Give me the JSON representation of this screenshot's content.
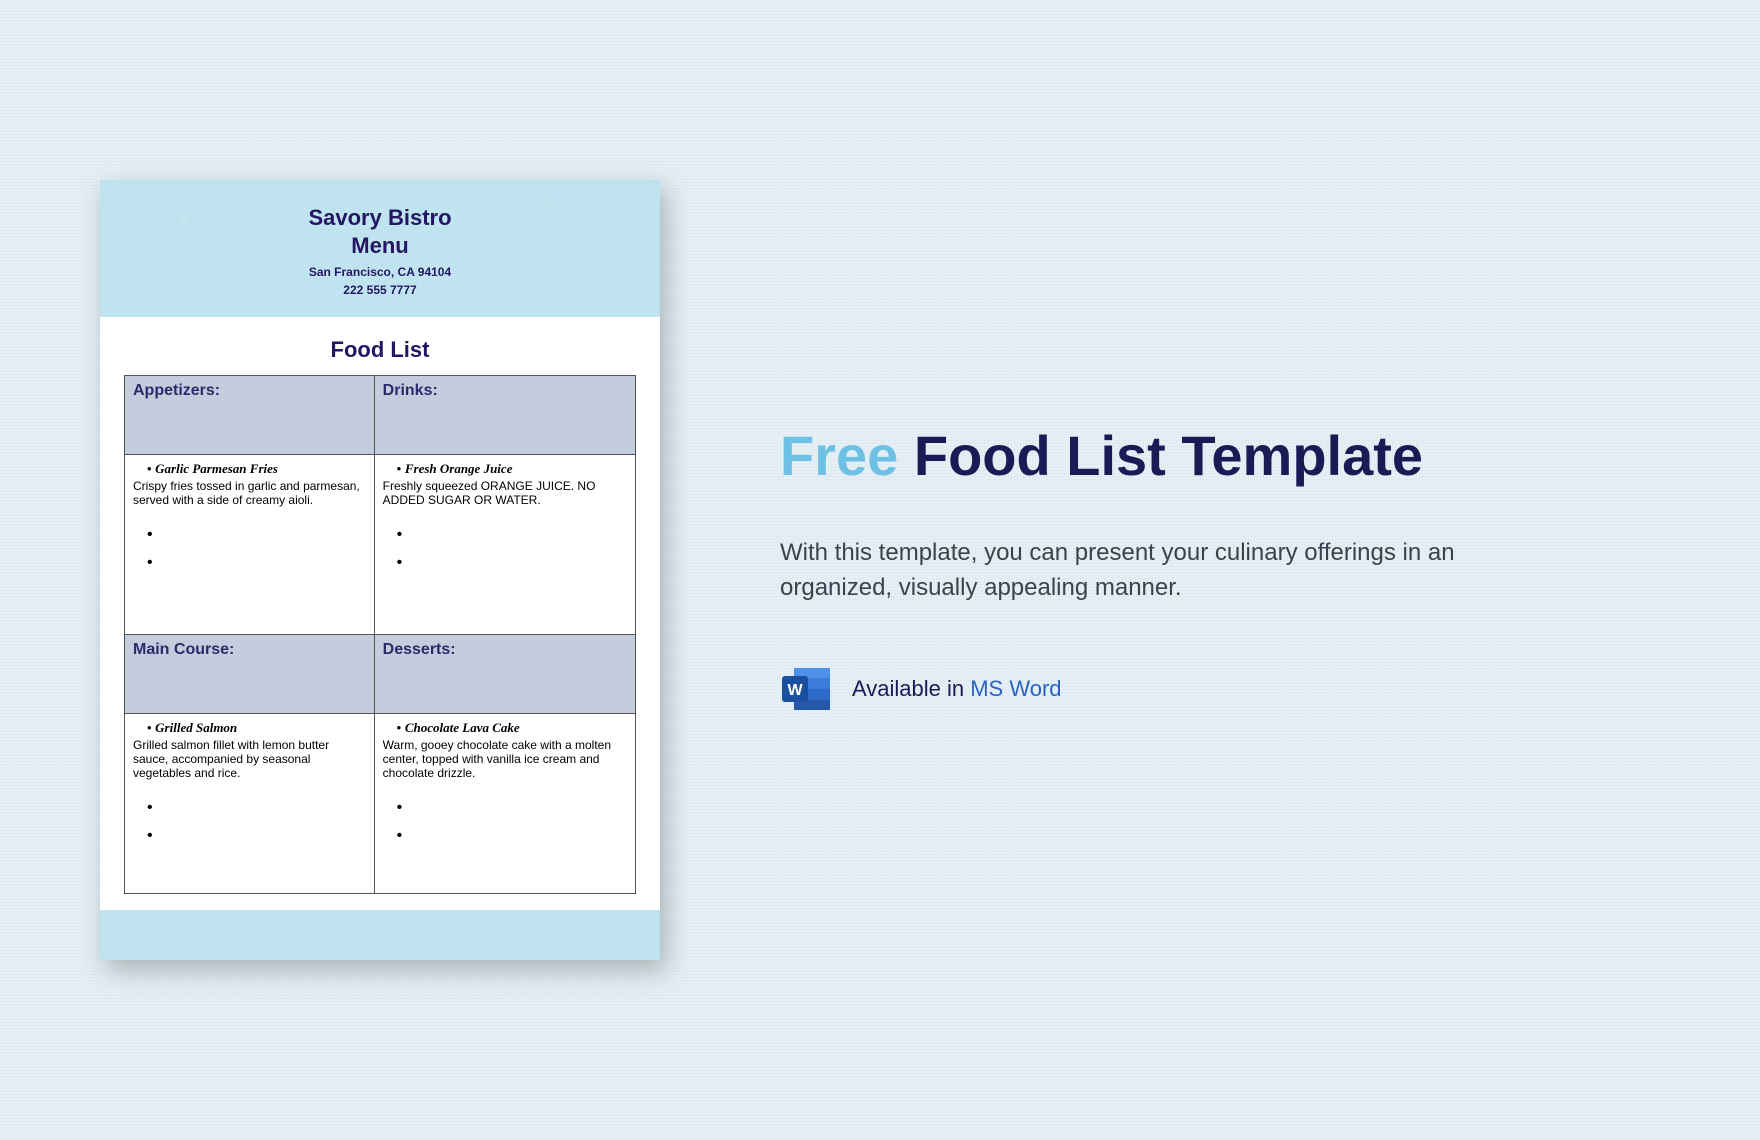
{
  "doc": {
    "title_line1": "Savory Bistro",
    "title_line2": "Menu",
    "location": "San Francisco, CA 94104",
    "phone": "222 555 7777",
    "list_heading": "Food List",
    "sections": {
      "appetizers": {
        "label": "Appetizers:",
        "item_name": "Garlic Parmesan Fries",
        "item_desc": "Crispy fries tossed in garlic and parmesan, served with a side of creamy aioli."
      },
      "drinks": {
        "label": "Drinks:",
        "item_name": "Fresh Orange Juice",
        "item_desc": "Freshly squeezed ORANGE JUICE. NO ADDED SUGAR OR WATER."
      },
      "main": {
        "label": "Main Course:",
        "item_name": "Grilled Salmon",
        "item_desc": "Grilled salmon fillet with lemon butter sauce, accompanied by seasonal vegetables and rice."
      },
      "desserts": {
        "label": "Desserts:",
        "item_name": "Chocolate Lava Cake",
        "item_desc": "Warm, gooey chocolate cake with a molten center, topped with vanilla ice cream and chocolate drizzle."
      }
    }
  },
  "promo": {
    "headline_free": "Free",
    "headline_rest": " Food List Template",
    "description": "With this template, you can present your culinary offerings in an organized, visually appealing manner.",
    "available_prefix": "Available in ",
    "available_app": "MS Word"
  }
}
